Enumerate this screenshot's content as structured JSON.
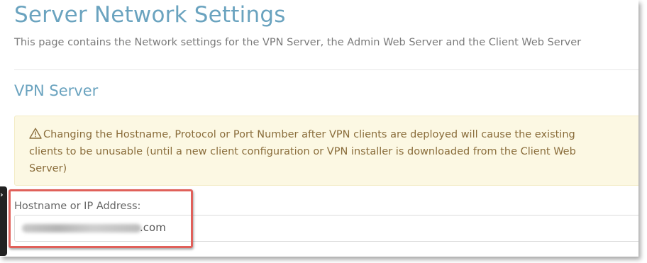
{
  "page": {
    "title": "Server Network Settings",
    "subtitle": "This page contains the Network settings for the VPN Server, the Admin Web Server and the Client Web Server"
  },
  "vpn_section": {
    "title": "VPN Server",
    "warning": {
      "icon": "warning-triangle-icon",
      "text": "Changing the Hostname, Protocol or Port Number after VPN clients are deployed will cause the existing clients to be unusable (until a new client configuration or VPN installer is downloaded from the Client Web Server)"
    },
    "hostname_field": {
      "label": "Hostname or IP Address:",
      "value_visible_suffix": ".com"
    }
  },
  "side_tab": {
    "icon": "chevron-right-icon"
  },
  "colors": {
    "heading": "#6aa3bf",
    "warning_bg": "#fcf8e3",
    "warning_text": "#8a6d3b",
    "highlight": "#e0605a"
  }
}
